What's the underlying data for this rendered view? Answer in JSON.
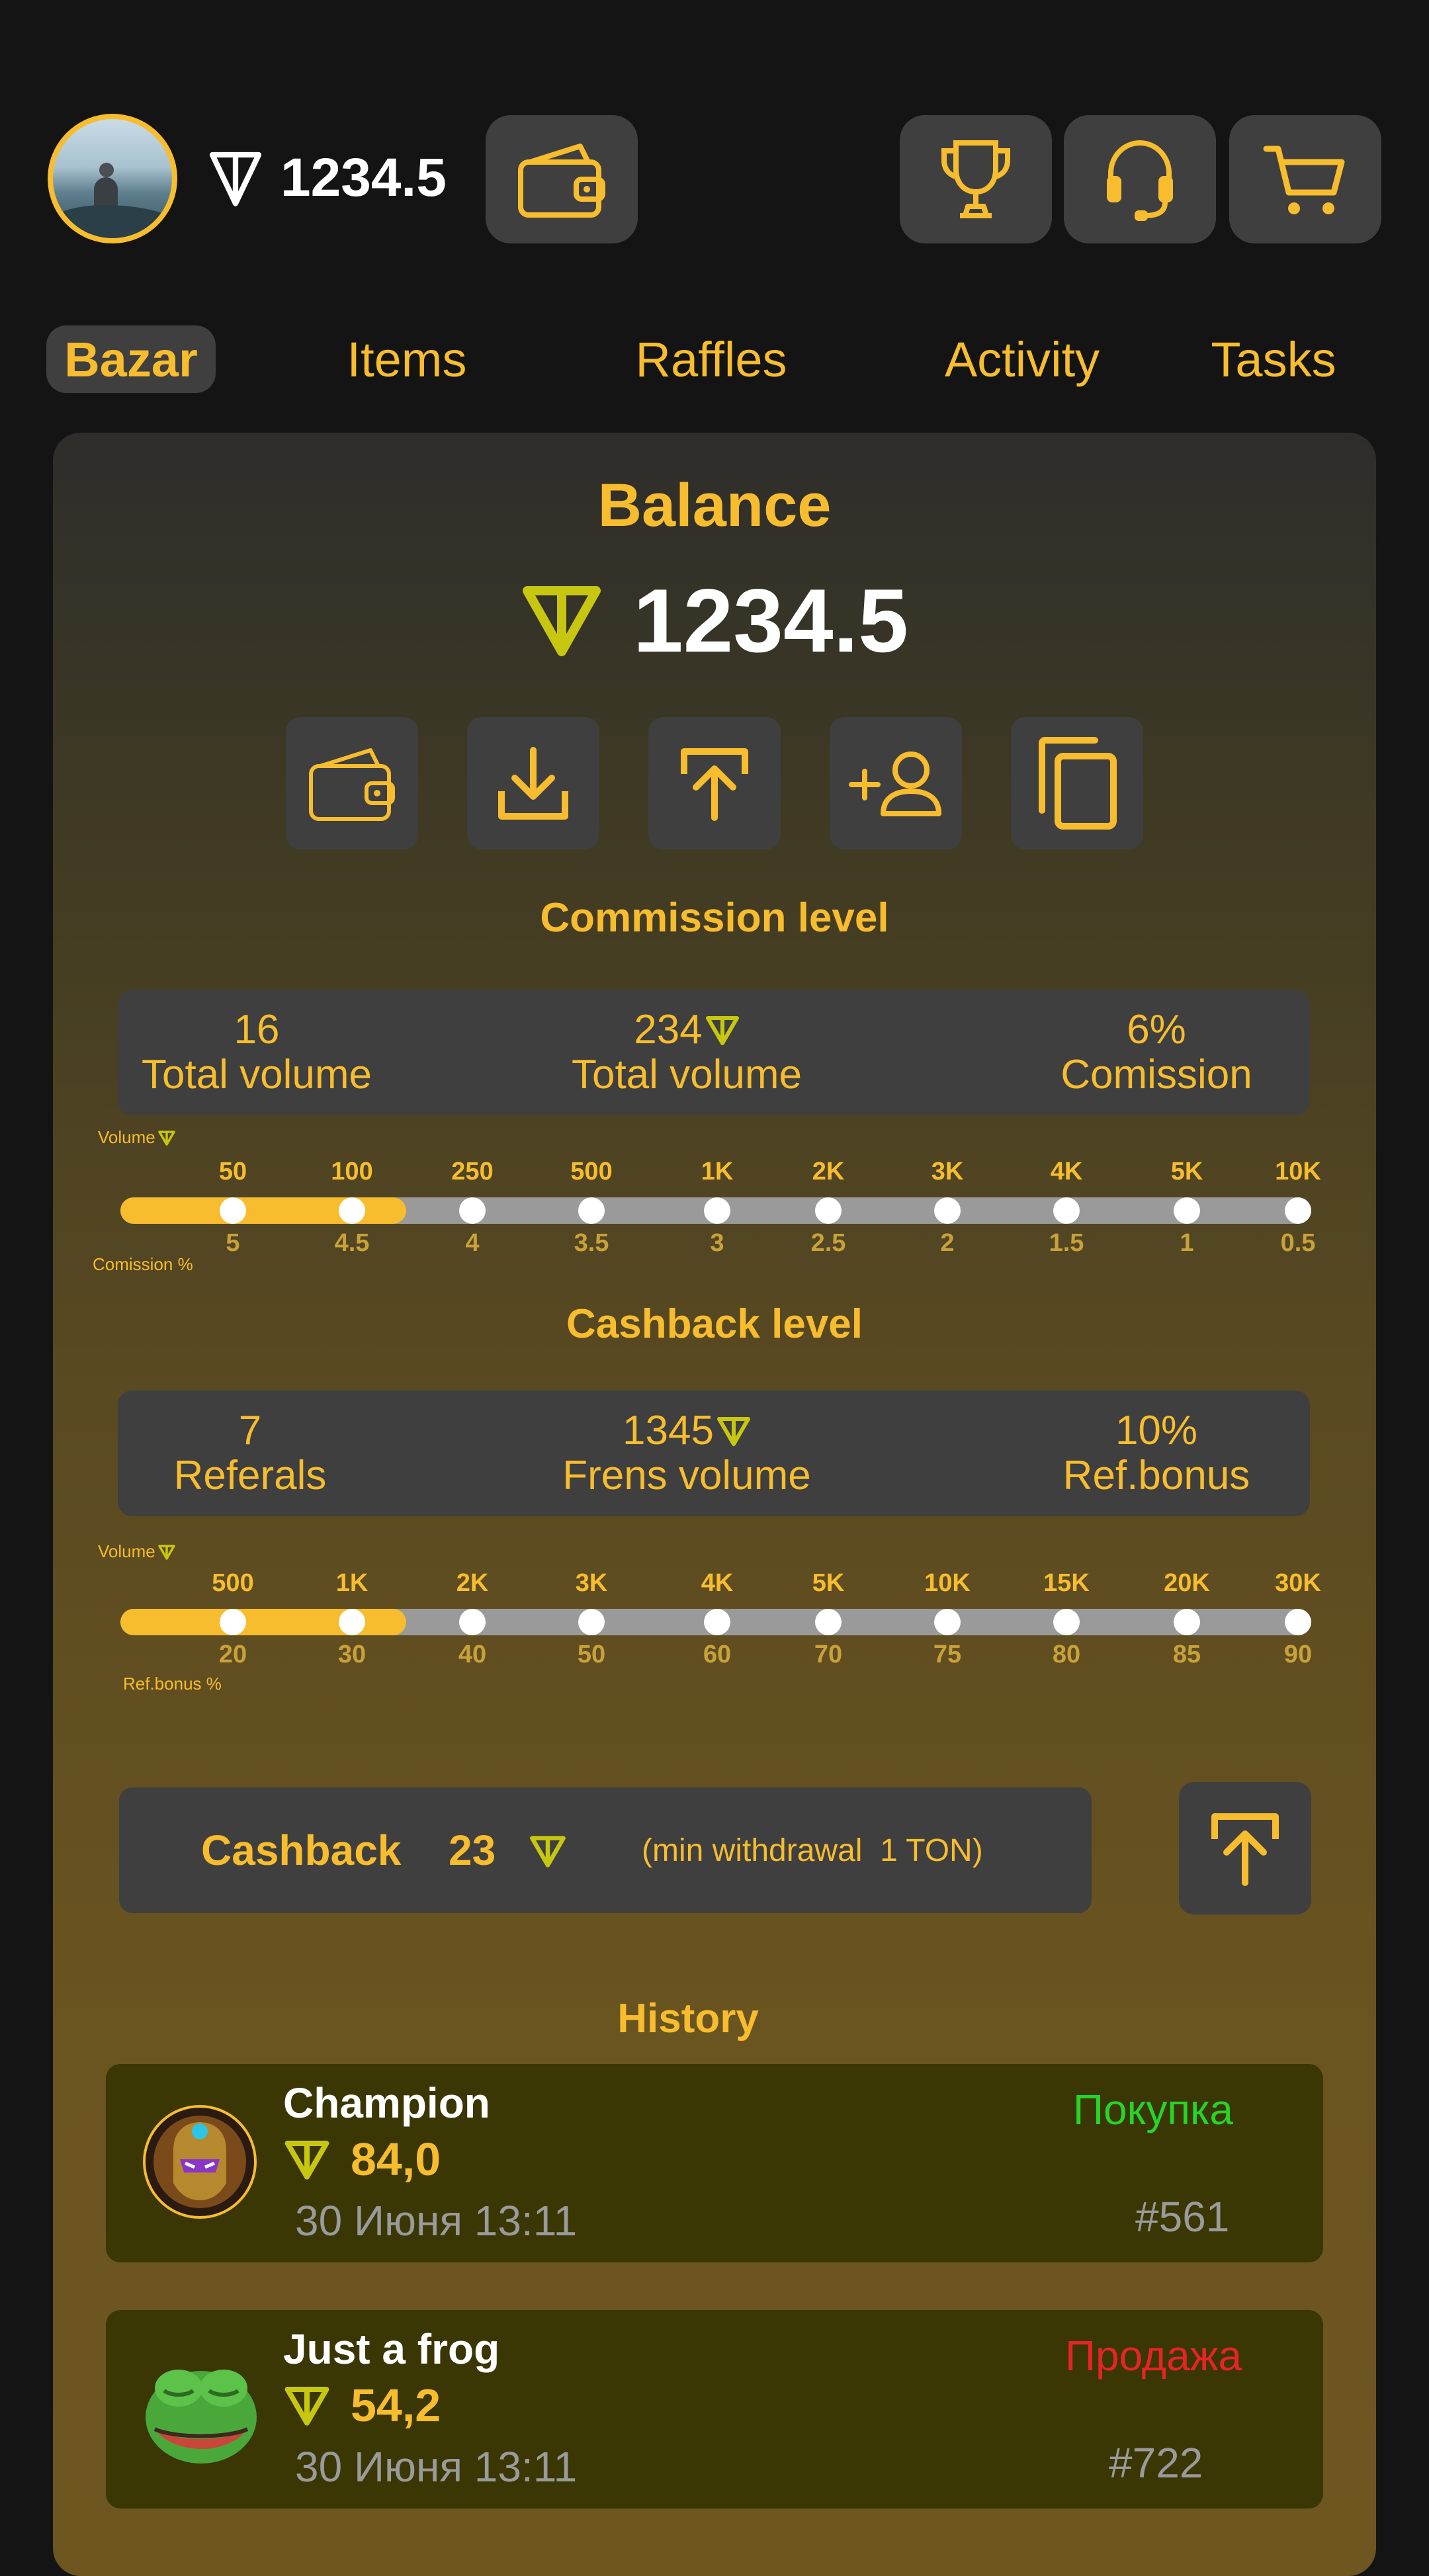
{
  "header": {
    "balance": "1234.5",
    "icons": [
      "wallet-icon",
      "trophy-icon",
      "headset-icon",
      "cart-icon"
    ]
  },
  "tabs": [
    {
      "label": "Bazar",
      "active": true
    },
    {
      "label": "Items",
      "active": false
    },
    {
      "label": "Raffles",
      "active": false
    },
    {
      "label": "Activity",
      "active": false
    },
    {
      "label": "Tasks",
      "active": false
    }
  ],
  "balance": {
    "title": "Balance",
    "amount": "1234.5",
    "actions": [
      "wallet-icon",
      "download-icon",
      "upload-icon",
      "add-user-icon",
      "copy-icon"
    ]
  },
  "commission": {
    "title": "Commission level",
    "stats": [
      {
        "value": "16",
        "label": "Total volume",
        "ton": false
      },
      {
        "value": "234",
        "label": "Total volume",
        "ton": true
      },
      {
        "value": "6%",
        "label": "Comission",
        "ton": false
      }
    ],
    "volume_label": "Volume",
    "bottom_label": "Comission %",
    "levels_top": [
      "50",
      "100",
      "250",
      "500",
      "1K",
      "2K",
      "3K",
      "4K",
      "5K",
      "10K"
    ],
    "levels_bottom": [
      "5",
      "4.5",
      "4",
      "3.5",
      "3",
      "2.5",
      "2",
      "1.5",
      "1",
      "0.5"
    ],
    "progress": 0.24
  },
  "cashback_level": {
    "title": "Cashback level",
    "stats": [
      {
        "value": "7",
        "label": "Referals",
        "ton": false
      },
      {
        "value": "1345",
        "label": "Frens volume",
        "ton": true
      },
      {
        "value": "10%",
        "label": "Ref.bonus",
        "ton": false
      }
    ],
    "volume_label": "Volume",
    "bottom_label": "Ref.bonus %",
    "levels_top": [
      "500",
      "1K",
      "2K",
      "3K",
      "4K",
      "5K",
      "10K",
      "15K",
      "20K",
      "30K"
    ],
    "levels_bottom": [
      "20",
      "30",
      "40",
      "50",
      "60",
      "70",
      "75",
      "80",
      "85",
      "90"
    ],
    "progress": 0.24
  },
  "cashback": {
    "label": "Cashback",
    "amount": "23",
    "note": "(min withdrawal  1 TON)"
  },
  "history": {
    "title": "History",
    "items": [
      {
        "name": "Champion",
        "price": "84,0",
        "date": "30 Июня 13:11",
        "type": "Покупка",
        "type_color": "#27d427",
        "id": "#561",
        "avatar": "knight-avatar"
      },
      {
        "name": "Just a frog",
        "price": "54,2",
        "date": "30 Июня 13:11",
        "type": "Продажа",
        "type_color": "#e62424",
        "id": "#722",
        "avatar": "frog-avatar"
      }
    ]
  },
  "colors": {
    "accent": "#f7bd2e",
    "ton": "#c7c711",
    "panel": "#3f3f3f",
    "background": "#141414"
  }
}
